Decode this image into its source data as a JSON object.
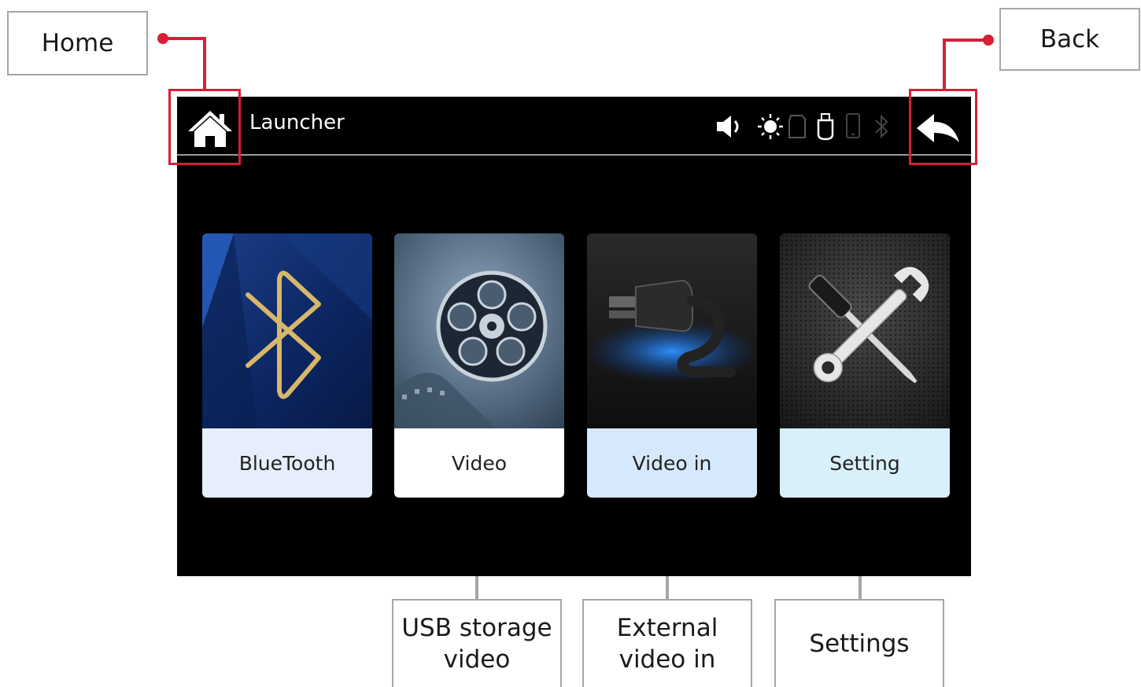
{
  "callouts": {
    "home": "Home",
    "back": "Back",
    "usb_line1": "USB storage",
    "usb_line2": "video",
    "ext_line1": "External",
    "ext_line2": "video in",
    "settings": "Settings"
  },
  "topbar": {
    "title": "Launcher",
    "icons": [
      "home-icon",
      "volume-icon",
      "brightness-icon",
      "sd-card-icon",
      "usb-icon",
      "phone-icon",
      "bluetooth-icon",
      "back-arrow-icon"
    ]
  },
  "apps": [
    {
      "label": "BlueTooth",
      "icon": "bluetooth-icon"
    },
    {
      "label": "Video",
      "icon": "film-reel-icon"
    },
    {
      "label": "Video in",
      "icon": "plug-icon"
    },
    {
      "label": "Setting",
      "icon": "tools-icon"
    }
  ],
  "colors": {
    "callout_line_red": "#d91e36",
    "callout_line_gray": "#a6a6a6",
    "screen_bg": "#000000",
    "bluetooth_label_bg": "#e6eefb",
    "video_label_bg": "#ffffff",
    "videoin_label_bg": "#d6e8fb",
    "setting_label_bg": "#d9f0fb"
  }
}
